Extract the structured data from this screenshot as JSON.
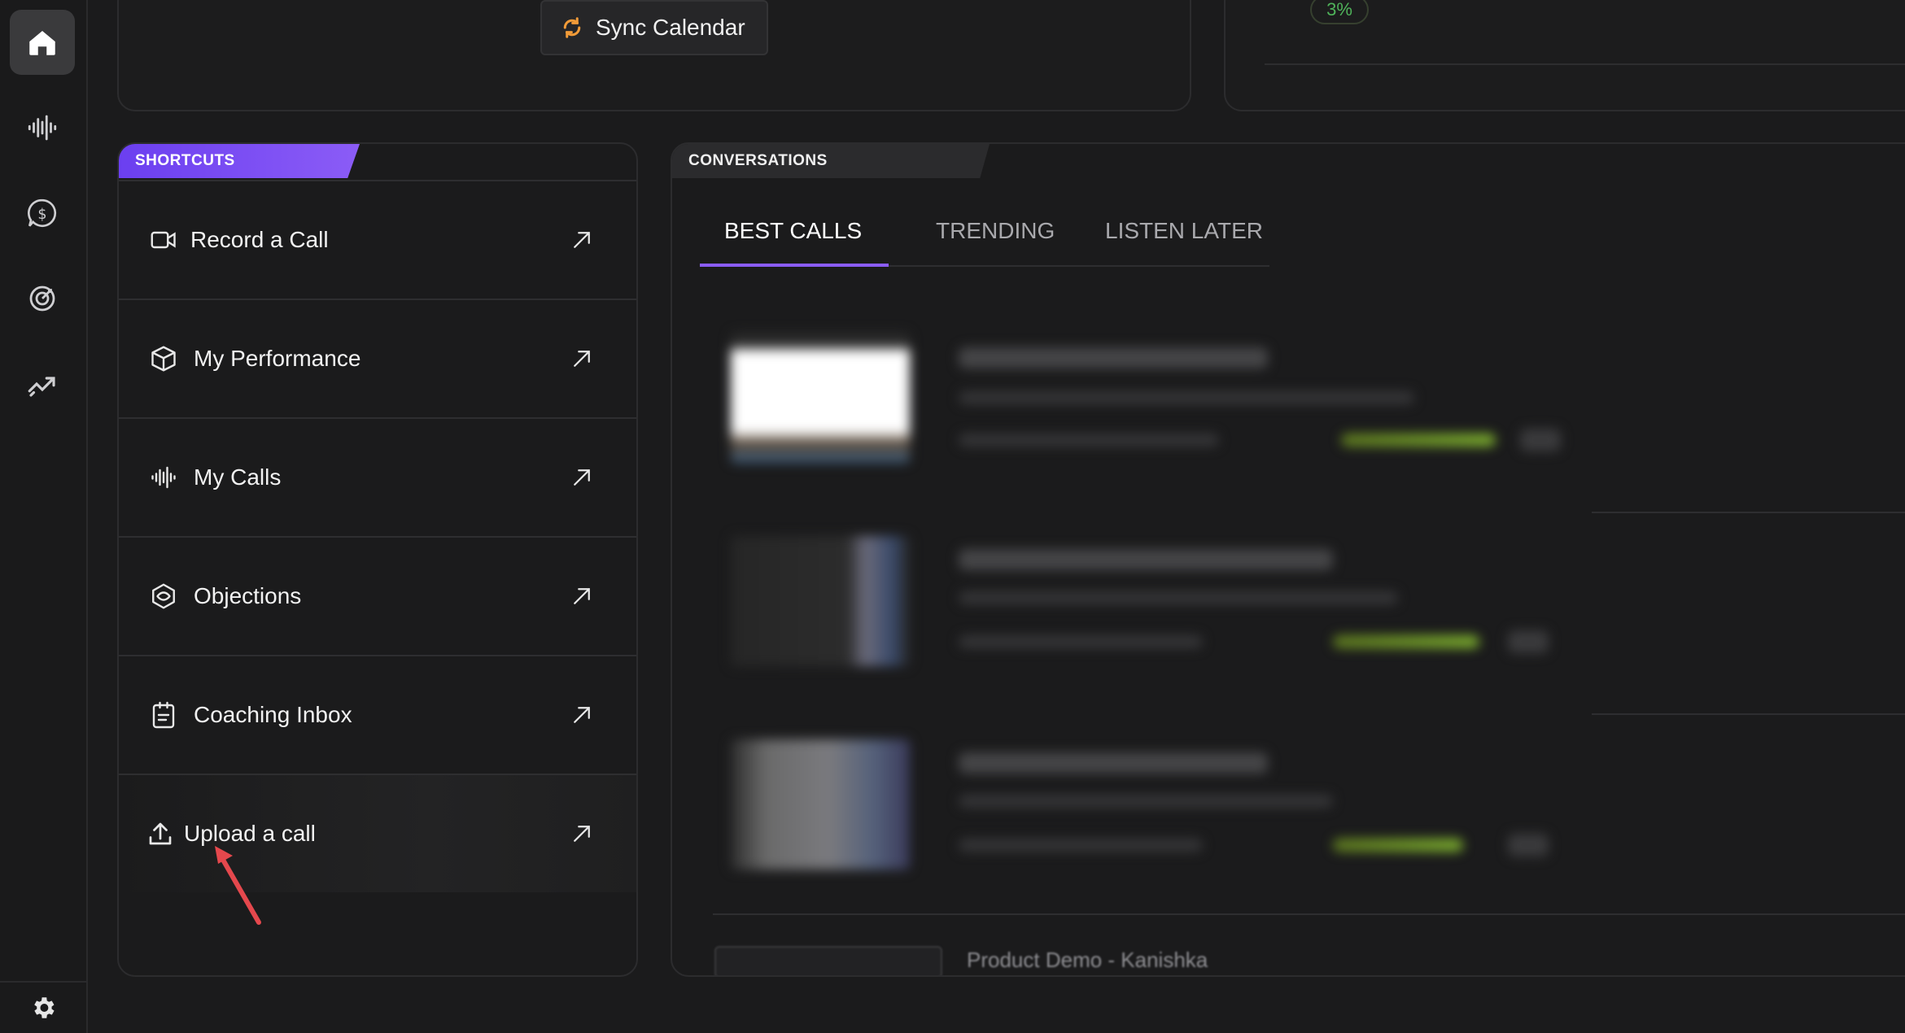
{
  "sidebar": {
    "items": [
      {
        "icon": "home-icon",
        "active": true
      },
      {
        "icon": "waveform-icon",
        "active": false
      },
      {
        "icon": "deal-chat-icon",
        "active": false
      },
      {
        "icon": "target-icon",
        "active": false
      },
      {
        "icon": "analytics-icon",
        "active": false
      }
    ],
    "bottom_icon": "settings-gear-icon"
  },
  "top": {
    "sync_calendar_label": "Sync Calendar",
    "percent_badge": "3%"
  },
  "shortcuts": {
    "tag": "SHORTCUTS",
    "items": [
      {
        "label": "Record a Call",
        "icon": "video-camera-icon"
      },
      {
        "label": "My Performance",
        "icon": "cube-icon"
      },
      {
        "label": "My Calls",
        "icon": "waveform-icon"
      },
      {
        "label": "Objections",
        "icon": "hexagon-eye-icon"
      },
      {
        "label": "Coaching Inbox",
        "icon": "clipboard-icon"
      },
      {
        "label": "Upload a call",
        "icon": "upload-icon"
      }
    ]
  },
  "conversations": {
    "tag": "CONVERSATIONS",
    "tabs": [
      {
        "label": "BEST CALLS",
        "active": true
      },
      {
        "label": "TRENDING",
        "active": false
      },
      {
        "label": "LISTEN LATER",
        "active": false
      }
    ],
    "last_item_title": "Product Demo - Kanishka"
  },
  "colors": {
    "accent": "#8b5cf6",
    "background": "#1b1b1c",
    "badge_green": "#4fb35a",
    "annotation_red": "#e5484d"
  }
}
